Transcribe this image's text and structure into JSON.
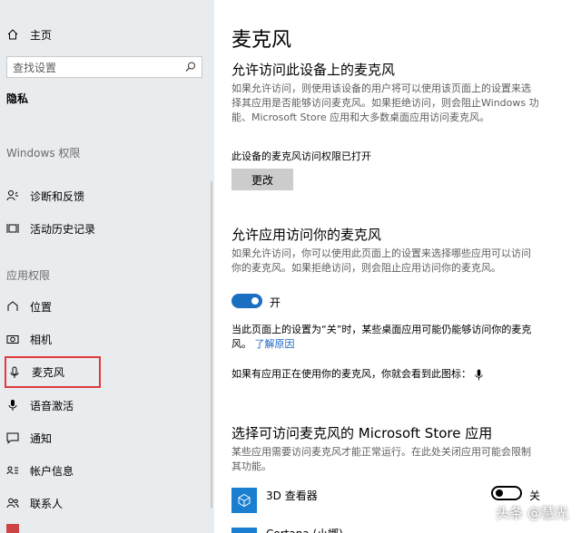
{
  "sidebar": {
    "home_label": "主页",
    "search_placeholder": "查找设置",
    "privacy_title": "隐私",
    "windows_section": "Windows 权限",
    "items_windows": [
      {
        "label": "诊断和反馈",
        "icon": "feedback-icon"
      },
      {
        "label": "活动历史记录",
        "icon": "activity-history-icon"
      }
    ],
    "app_section": "应用权限",
    "items_app": [
      {
        "label": "位置",
        "icon": "location-icon"
      },
      {
        "label": "相机",
        "icon": "camera-icon"
      },
      {
        "label": "麦克风",
        "icon": "microphone-icon"
      },
      {
        "label": "语音激活",
        "icon": "voice-activation-icon"
      },
      {
        "label": "通知",
        "icon": "notifications-icon"
      },
      {
        "label": "帐户信息",
        "icon": "account-info-icon"
      },
      {
        "label": "联系人",
        "icon": "contacts-icon"
      }
    ]
  },
  "main": {
    "page_title": "麦克风",
    "section1": {
      "heading": "允许访问此设备上的麦克风",
      "desc": "如果允许访问，则使用该设备的用户将可以使用该页面上的设置来选择其应用是否能够访问麦克风。如果拒绝访问，则会阻止Windows 功能、Microsoft Store 应用和大多数桌面应用访问麦克风。",
      "status": "此设备的麦克风访问权限已打开",
      "change_button": "更改"
    },
    "section2": {
      "heading": "允许应用访问你的麦克风",
      "desc": "如果允许访问，你可以使用此页面上的设置来选择哪些应用可以访问你的麦克风。如果拒绝访问，则会阻止应用访问你的麦克风。",
      "toggle_label": "开",
      "note_text": "当此页面上的设置为“关”时，某些桌面应用可能仍能够访问你的麦克风。",
      "note_link": "了解原因",
      "indicator_text": "如果有应用正在使用你的麦克风，你就会看到此图标："
    },
    "section3": {
      "heading": "选择可访问麦克风的 Microsoft Store 应用",
      "desc": "某些应用需要访问麦克风才能正常运行。在此处关闭应用可能会限制其功能。",
      "apps": [
        {
          "name": "3D 查看器",
          "state": "关"
        }
      ],
      "partial_app": "Cortana (小娜)"
    }
  },
  "watermark": "头条 @慧光",
  "colors": {
    "sidebar_bg": "#e9ecef",
    "accent": "#1b6fc0",
    "highlight_box": "#e03a3a"
  }
}
